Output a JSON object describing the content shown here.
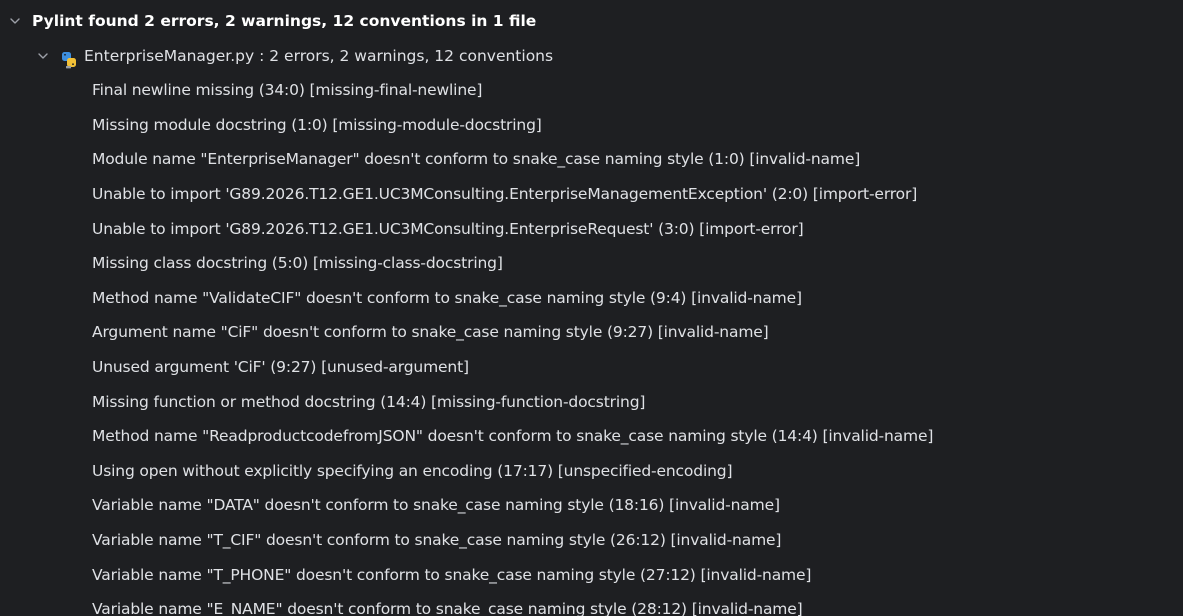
{
  "root": {
    "label": "Pylint found 2 errors, 2 warnings, 12 conventions  in 1 file"
  },
  "file": {
    "label": "EnterpriseManager.py : 2 errors, 2 warnings, 12 conventions",
    "icon": "python-file-icon"
  },
  "issues": [
    "Final newline missing (34:0) [missing-final-newline]",
    "Missing module docstring (1:0) [missing-module-docstring]",
    "Module name \"EnterpriseManager\" doesn't conform to snake_case naming style (1:0) [invalid-name]",
    "Unable to import 'G89.2026.T12.GE1.UC3MConsulting.EnterpriseManagementException' (2:0) [import-error]",
    "Unable to import 'G89.2026.T12.GE1.UC3MConsulting.EnterpriseRequest' (3:0) [import-error]",
    "Missing class docstring (5:0) [missing-class-docstring]",
    "Method name \"ValidateCIF\" doesn't conform to snake_case naming style (9:4) [invalid-name]",
    "Argument name \"CiF\" doesn't conform to snake_case naming style (9:27) [invalid-name]",
    "Unused argument 'CiF' (9:27) [unused-argument]",
    "Missing function or method docstring (14:4) [missing-function-docstring]",
    "Method name \"ReadproductcodefromJSON\" doesn't conform to snake_case naming style (14:4) [invalid-name]",
    "Using open without explicitly specifying an encoding (17:17) [unspecified-encoding]",
    "Variable name \"DATA\" doesn't conform to snake_case naming style (18:16) [invalid-name]",
    "Variable name \"T_CIF\" doesn't conform to snake_case naming style (26:12) [invalid-name]",
    "Variable name \"T_PHONE\" doesn't conform to snake_case naming style (27:12) [invalid-name]",
    "Variable name \"E_NAME\" doesn't conform to snake_case naming style (28:12) [invalid-name]"
  ],
  "colors": {
    "background": "#1e1f22",
    "text": "#dfe1e5",
    "chevron": "#9da0a8",
    "python_blue": "#3d8fe0",
    "python_yellow": "#f2c037"
  }
}
